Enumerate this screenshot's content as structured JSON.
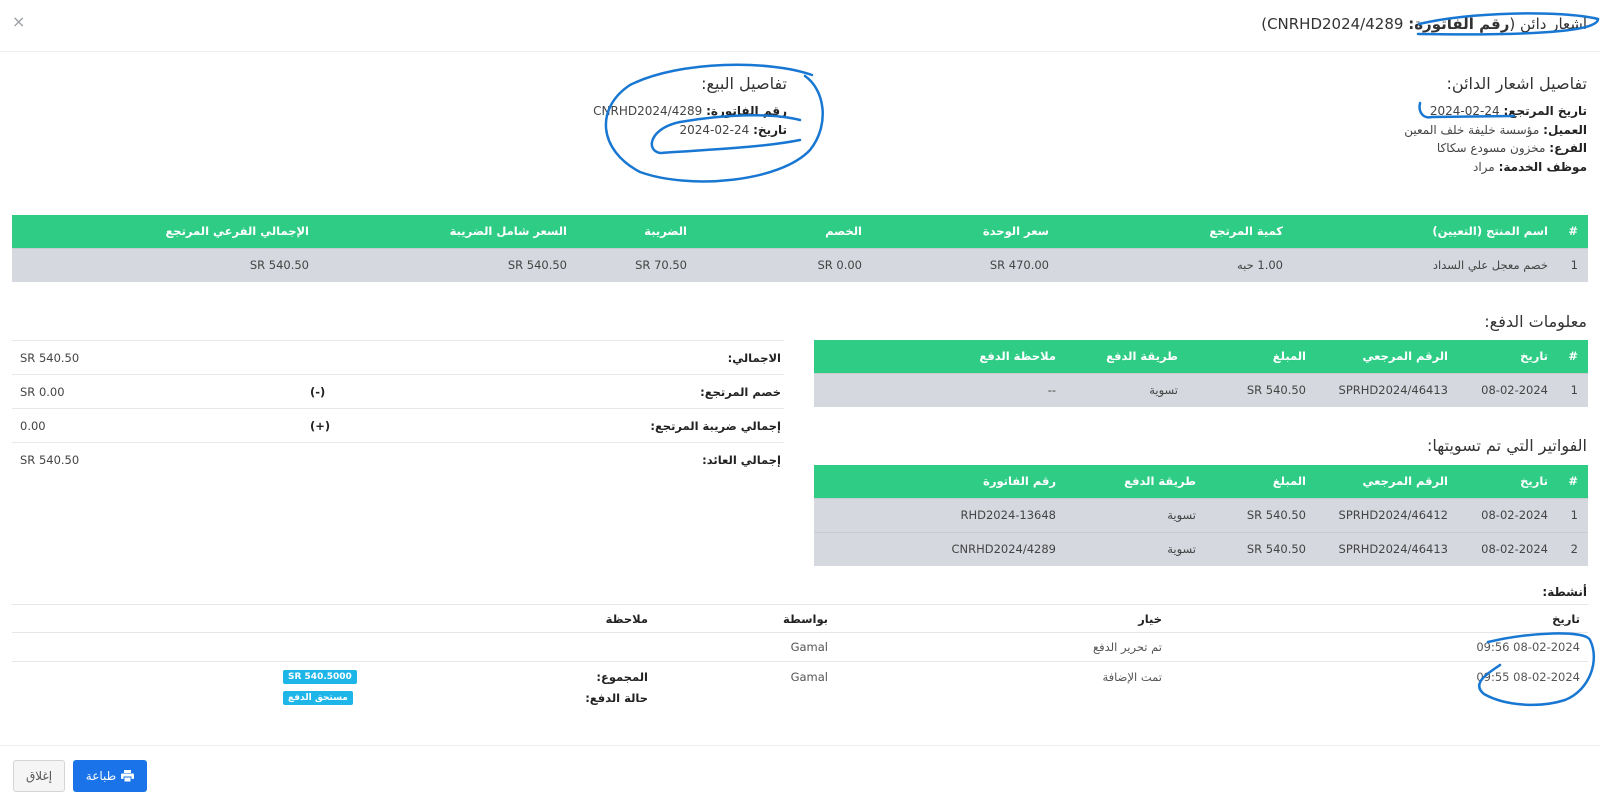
{
  "modal": {
    "title_prefix": "اشعار دائن",
    "title_label": "رقم الفاتورة:",
    "title_value": "CNRHD2024/4289",
    "close_glyph": "×"
  },
  "credit_note_details": {
    "heading": "تفاصيل اشعار الدائن:",
    "return_date_label": "تاريخ المرتجع:",
    "return_date": "24-02-2024",
    "customer_label": "العميل:",
    "customer": "مؤسسة خليفة خلف المعين",
    "branch_label": "الفرع:",
    "branch": "مخزون مسودع سكاكا",
    "employee_label": "موظف الخدمة:",
    "employee": "مراد"
  },
  "sale_details": {
    "heading": "تفاصيل البيع:",
    "invoice_label": "رقم الفاتورة:",
    "invoice": "CNRHD2024/4289",
    "date_label": "تاريخ:",
    "date": "24-02-2024"
  },
  "products": {
    "headers": [
      "#",
      "اسم المنتج (التعيين)",
      "كمية المرتجع",
      "سعر الوحدة",
      "الخصم",
      "الضريبة",
      "السعر شامل الضريبة",
      "الإجمالي الفرعي المرتجع"
    ],
    "rows": [
      [
        "1",
        "خصم معجل علي السداد",
        "1.00 حبه",
        "SR 470.00",
        "SR 0.00",
        "SR 70.50",
        "SR 540.50",
        "SR 540.50"
      ]
    ]
  },
  "payment_info": {
    "heading": "معلومات الدفع:",
    "headers": [
      "#",
      "تاريخ",
      "الرقم المرجعي",
      "المبلغ",
      "طريقة الدفع",
      "ملاحظة الدفع"
    ],
    "rows": [
      [
        "1",
        "08-02-2024",
        "SPRHD2024/46413",
        "SR 540.50",
        "تسوية",
        "--"
      ]
    ]
  },
  "settled_invoices": {
    "heading": "الفواتير التي تم تسويتها:",
    "headers": [
      "#",
      "تاريخ",
      "الرقم المرجعي",
      "المبلغ",
      "طريقة الدفع",
      "رقم الفاتورة"
    ],
    "rows": [
      [
        "1",
        "08-02-2024",
        "SPRHD2024/46412",
        "SR 540.50",
        "تسوية",
        "RHD2024-13648"
      ],
      [
        "2",
        "08-02-2024",
        "SPRHD2024/46413",
        "SR 540.50",
        "تسوية",
        "CNRHD2024/4289"
      ]
    ]
  },
  "totals": {
    "total_label": "الاجمالي:",
    "total_value": "SR 540.50",
    "return_discount_label": "خصم المرتجع:",
    "return_discount_symbol": "(-)",
    "return_discount_value": "SR 0.00",
    "return_tax_label": "إجمالي ضريبة المرتجع:",
    "return_tax_symbol": "(+)",
    "return_tax_value": "0.00",
    "return_total_label": "إجمالي العائد:",
    "return_total_value": "SR 540.50"
  },
  "activities": {
    "heading": "أنشطة:",
    "headers": [
      "تاريخ",
      "خيار",
      "بواسطة",
      "ملاحظة"
    ],
    "rows": [
      [
        "08-02-2024 09:56",
        "تم تحرير الدفع",
        "Gamal"
      ],
      [
        "08-02-2024 09:55",
        "تمت الإضافة",
        "Gamal"
      ]
    ],
    "sum_label": "المجموع:",
    "sum_badge": "SR 540.5000",
    "payment_status_label": "حالة الدفع:",
    "payment_status_badge": "مستحق الدفع"
  },
  "footer": {
    "print_label": "طباعة",
    "close_label": "إغلاق"
  },
  "colors": {
    "table_header": "#2ecc85",
    "table_row": "#d5d8de",
    "primary_button": "#1a73e8",
    "badge": "#1eb6e8",
    "annotation_ink": "#1877d2"
  }
}
